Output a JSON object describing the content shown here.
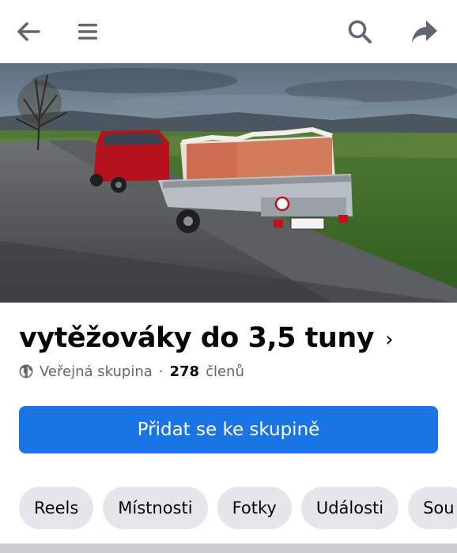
{
  "topbar": {
    "icons": [
      "back-arrow-icon",
      "menu-icon",
      "search-icon",
      "share-icon"
    ]
  },
  "cover": {
    "description_icon": "cover-photo"
  },
  "group": {
    "name": "vytěžováky do 3,5 tuny",
    "chevron": "›",
    "privacy": "Veřejná skupina",
    "separator": "·",
    "member_count": "278",
    "members_label": "členů"
  },
  "join_button": {
    "label": "Přidat se ke skupině"
  },
  "tabs": [
    {
      "label": "Reels"
    },
    {
      "label": "Místnosti"
    },
    {
      "label": "Fotky"
    },
    {
      "label": "Události"
    },
    {
      "label": "Sou"
    }
  ],
  "colors": {
    "accent": "#1b74e4",
    "chip_bg": "#e4e6eb",
    "secondary_text": "#65676b"
  }
}
